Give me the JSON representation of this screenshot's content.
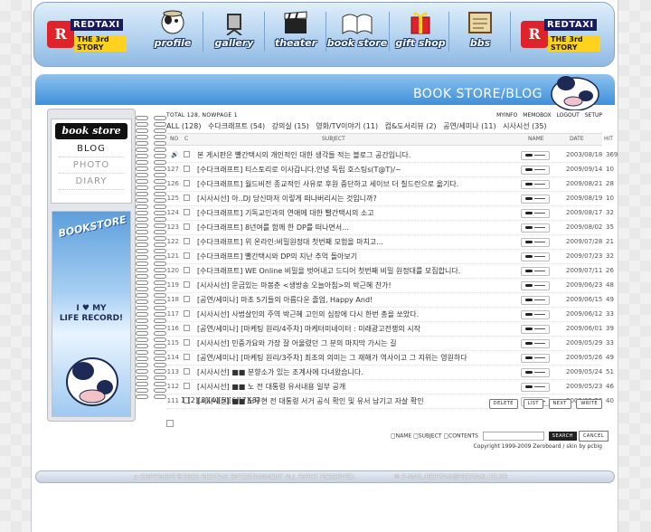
{
  "nav": {
    "logo_text": "REDTAXI",
    "logo_sub": "THE 3rd STORY",
    "items": [
      {
        "label": "profile",
        "icon": "profile-icon"
      },
      {
        "label": "gallery",
        "icon": "gallery-icon"
      },
      {
        "label": "theater",
        "icon": "theater-icon"
      },
      {
        "label": "book store",
        "icon": "book-icon"
      },
      {
        "label": "gift shop",
        "icon": "gift-icon"
      },
      {
        "label": "bbs",
        "icon": "bbs-icon"
      }
    ]
  },
  "page_title": "BOOK STORE/BLOG",
  "sidebar": {
    "title": "book store",
    "links": [
      "BLOG",
      "PHOTO",
      "DIARY"
    ],
    "banner_title": "BOOKSTORE",
    "banner_line1": "I ♥ MY",
    "banner_line2": "LIFE RECORD!"
  },
  "board": {
    "total_label": "TOTAL",
    "total": "128",
    "page_label": "NOWPAGE",
    "page": "1",
    "top_links": [
      "MYINFO",
      "MEMOBOX",
      "LOGOUT",
      "SETUP"
    ],
    "categories": [
      "ALL (128)",
      "수다크래프트 (54)",
      "강의실 (15)",
      "영화/TV이야기 (11)",
      "컵&도서리뷰 (2)",
      "공연/세미나 (11)",
      "시사시선 (35)"
    ],
    "columns": {
      "no": "NO",
      "c": "C",
      "subject": "SUBJECT",
      "name": "NAME",
      "date": "DATE",
      "hit": "HIT"
    },
    "rows": [
      {
        "no": "",
        "subject": "본 게시판은 빨간택시의 개인적인 대한 생각들 적는 블로그 공간입니다.",
        "date": "2003/08/18",
        "hit": "369"
      },
      {
        "no": "127",
        "subject": "[수다크래프트] 티스토리로 이사갑니다.안녕 독립 호스팅s(T@T)/~",
        "date": "2009/09/14",
        "hit": "10"
      },
      {
        "no": "126",
        "subject": "[수다크래프트] 월드비전 종교적인 사유로 후원 중단하고 세이브 더 칠드런으로 옮기다.",
        "date": "2009/08/21",
        "hit": "28"
      },
      {
        "no": "125",
        "subject": "[시사시선] 아..DJ 당신마저 이렇게 떠나버리시는 것입니까?",
        "date": "2009/08/19",
        "hit": "10"
      },
      {
        "no": "124",
        "subject": "[수다크래프트] 기독교인과의 연애에 대한 빨간택시의 소고",
        "date": "2009/08/17",
        "hit": "32"
      },
      {
        "no": "123",
        "subject": "[수다크래프트] 8년여를 함께 한 DP를 떠나면서...",
        "date": "2009/08/02",
        "hit": "35"
      },
      {
        "no": "122",
        "subject": "[수다크래프트] 위 온라인:비밀원정대 첫번째 모험을 마치고...",
        "date": "2009/07/28",
        "hit": "21"
      },
      {
        "no": "121",
        "subject": "[수다크래프트] 빨간택시와 DP의 지난 추억 돌아보기",
        "date": "2009/07/23",
        "hit": "32"
      },
      {
        "no": "120",
        "subject": "[수다크래프트] WE Online 비밀을 벗어내고 드디어 첫번째 비밀 원정대를 모집합니다.",
        "date": "2009/07/11",
        "hit": "26"
      },
      {
        "no": "119",
        "subject": "[시사시선] 문금있는 마봉춘 <생방송 오늘아침>의 박근혜 찬가!",
        "date": "2009/06/23",
        "hit": "48"
      },
      {
        "no": "118",
        "subject": "[공연/세미나] 마초 5기들의 아름다운 졸업, Happy And!",
        "date": "2009/06/15",
        "hit": "49"
      },
      {
        "no": "117",
        "subject": "[시사시선] 사법살인의 주역 박근혜 고인의 심장에 다시 한번 총을 쏘았다.",
        "date": "2009/06/12",
        "hit": "33"
      },
      {
        "no": "116",
        "subject": "[공연/세미나] [마케팅 원리/4주차] 마케터미네이터 : 미래광고전쟁의 시작",
        "date": "2009/06/01",
        "hit": "39"
      },
      {
        "no": "115",
        "subject": "[시사시선] 민중가요와 가장 잘 어울렸던 그 분의 마지막 가시는 길",
        "date": "2009/05/29",
        "hit": "33"
      },
      {
        "no": "114",
        "subject": "[공연/세미나] [마케팅 원리/3주차] 최초의 의미는 그 재해가 역사이고 그 지위는 영원하다",
        "date": "2009/05/26",
        "hit": "49"
      },
      {
        "no": "113",
        "subject": "[시사시선] ■■ 분향소가 있는 조계사에 다녀왔습니다.",
        "date": "2009/05/24",
        "hit": "51"
      },
      {
        "no": "112",
        "subject": "[시사시선] ■■ 노 전 대통령 유서내용 일부 공개",
        "date": "2009/05/23",
        "hit": "46"
      },
      {
        "no": "111",
        "subject": "[시사시선] ■■ 노무현 전 대통령 서거 공식 확인 및 유서 남기고 자살 확인",
        "date": "2009/05/23",
        "hit": "40"
      }
    ],
    "pagination": "1 [2][3][4][5][6][7][8]",
    "buttons": [
      "DELETE",
      "LIST",
      "NEXT",
      "WRITE"
    ],
    "search_options": "□NAME □SUBJECT □CONTENTS",
    "search_value": "",
    "search_button": "SEARCH",
    "cancel_button": "CANCEL",
    "copyright": "Copyright 1999-2009 Zeroboard / skin by pcbig"
  },
  "footer": {
    "left": "COPYRIGHT©2003 REDTAXI ENTERTAINMENT ALL RIGHT RESERVED.",
    "right": "E-MAIL:REDTAXI@REDTAXI.CO.KR"
  }
}
